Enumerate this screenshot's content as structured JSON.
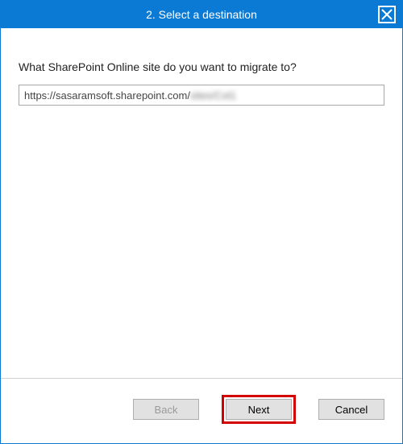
{
  "titlebar": {
    "title": "2. Select a destination"
  },
  "content": {
    "question": "What SharePoint Online site do you want to migrate to?",
    "url_visible": "https://sasaramsoft.sharepoint.com/",
    "url_obscured": "sites/Col1"
  },
  "footer": {
    "back_label": "Back",
    "next_label": "Next",
    "cancel_label": "Cancel"
  }
}
